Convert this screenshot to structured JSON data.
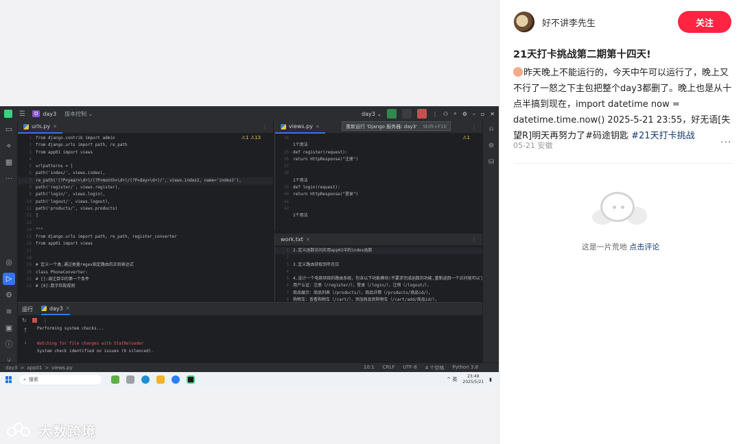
{
  "post": {
    "author": "好不讲李先生",
    "follow_label": "关注",
    "title": "21天打卡挑战第二期第十四天!",
    "body_part1": "昨天晚上不能运行的，今天中午可以运行了，晚上又不行了一怒之下主包把整个day3都删了。晚上也是从十点半搞到现在，import datetime now = datetime.time.now()  2025-5-21 23:55，好无语[失望R]明天再努力了#码途钥匙 ",
    "tag": "#21天打卡挑战",
    "meta": "05-21 安徽",
    "more": "···",
    "empty_text": "这是一片荒地 ",
    "empty_link": "点击评论"
  },
  "watermark": "大数跨境",
  "ide": {
    "project": "day3",
    "project_badge": "D",
    "version_control": "版本控制 ⌄",
    "run_config": "day3 ⌄",
    "tooltip": "重新运行 'Django 服务器: day3'",
    "tooltip_kbd": "Shift+F10",
    "left_tab": "urls.py",
    "right_tab": "views.py",
    "bottom_tab": "work.txt",
    "left_warn": "⚠1  ⚠13",
    "right_warn": "⚠1",
    "left_code": [
      {
        "n": "1",
        "t": "from django.contrib import admin"
      },
      {
        "n": "2",
        "t": "from django.urls import path, re_path"
      },
      {
        "n": "3",
        "t": "from app01 import views"
      },
      {
        "n": "4",
        "t": ""
      },
      {
        "n": "5",
        "t": "urlpatterns = ["
      },
      {
        "n": "6",
        "t": "    path('index/', views.index),"
      },
      {
        "n": "7",
        "t": "    re_path('(?P<year>\\d+)/(?P<month>\\d+)/(?P<day>\\d+)/', views.index2, name='index2'),"
      },
      {
        "n": "8",
        "t": "    path('register/', views.register),"
      },
      {
        "n": "9",
        "t": "    path('login/', views.login),"
      },
      {
        "n": "10",
        "t": "    path('logout/', views.logout),"
      },
      {
        "n": "11",
        "t": "    path('products/', views.products)"
      },
      {
        "n": "12",
        "t": "]"
      },
      {
        "n": "13",
        "t": ""
      },
      {
        "n": "14",
        "t": "\"\"\""
      },
      {
        "n": "15",
        "t": "from django.urls import path, re_path, register_converter"
      },
      {
        "n": "16",
        "t": "from app01 import views"
      },
      {
        "n": "17",
        "t": ""
      },
      {
        "n": "18",
        "t": ""
      },
      {
        "n": "19",
        "t": "# 定义一个类,通过类量regex指定路由的正则表达式"
      },
      {
        "n": "20",
        "t": "class PhoneConverter:"
      },
      {
        "n": "21",
        "t": "    # []:调注目中的第一个条件"
      },
      {
        "n": "22",
        "t": "    # [0]:数字匹配规则"
      }
    ],
    "right_code": [
      {
        "n": "34",
        "t": ""
      },
      {
        "n": "",
        "t": "1个用法"
      },
      {
        "n": "35",
        "t": "def register(request):"
      },
      {
        "n": "36",
        "t": "    return HttpResponse(\"注册\")"
      },
      {
        "n": "37",
        "t": ""
      },
      {
        "n": "38",
        "t": ""
      },
      {
        "n": "",
        "t": "1个用法"
      },
      {
        "n": "39",
        "t": "def login(request):"
      },
      {
        "n": "40",
        "t": "    return HttpResponse(\"登录\")"
      },
      {
        "n": "41",
        "t": ""
      },
      {
        "n": "42",
        "t": ""
      },
      {
        "n": "",
        "t": "1个用法"
      }
    ],
    "work_lines": [
      {
        "n": "1",
        "t": "2.定义函数访问应用app01中的index函数"
      },
      {
        "n": "2",
        "t": ""
      },
      {
        "n": "3",
        "t": "3.定义路由获取到年月日"
      },
      {
        "n": "4",
        "t": ""
      },
      {
        "n": "5",
        "t": "4.设计一个电商项目的路由系统，包含以下功能模块(不要求完成函数的功能,重新返回一个访问就可以了)"
      },
      {
        "n": "6",
        "t": "    用户认证：注册（/register/），登录（/login/），注销（/logout/），"
      },
      {
        "n": "7",
        "t": "    商品展示：商品列表（/products/），商品详情（/products/商品id/），"
      },
      {
        "n": "8",
        "t": "    购物车：查看购物车（/cart/），添加商品到购物车（/cart/add/商品id/），"
      }
    ],
    "run_label": "运行",
    "run_tab": "day3",
    "console": [
      {
        "cls": "ok",
        "t": "Performing system checks..."
      },
      {
        "cls": "ok",
        "t": ""
      },
      {
        "cls": "err",
        "t": "Watching for file changes with StatReloader"
      },
      {
        "cls": "ok",
        "t": "System check identified no issues (0 silenced)."
      }
    ],
    "status_crumbs": [
      "day3",
      ">",
      "app01",
      ">",
      "views.py"
    ],
    "status_info": [
      "10:1",
      "CRLF",
      "UTF-8",
      "4 个空格",
      "Python 3.8"
    ],
    "taskbar_search": "搜索",
    "tray_text": "^ 英",
    "clock_time": "23:49",
    "clock_date": "2025/5/21"
  },
  "colors": {
    "follow": "#ff2442",
    "tag": "#13386c",
    "ide_bg": "#1e1f22",
    "accent": "#3574f0"
  }
}
